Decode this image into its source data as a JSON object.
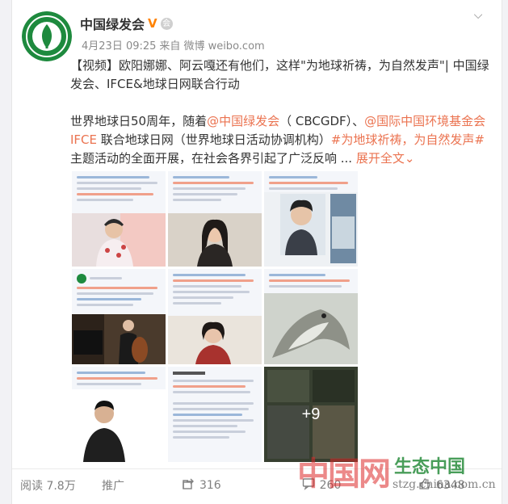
{
  "post": {
    "author": "中国绿发会",
    "verified_mark": "V",
    "vip_mark": "会",
    "date": "4月23日 09:25",
    "source_prefix": "来自",
    "source": "微博 weibo.com",
    "para1": "【视频】欧阳娜娜、阿云嘎还有他们，这样\"为地球祈祷，为自然发声\"| 中国绿发会、IFCE&地球日网联合行动",
    "para2_a": "世界地球日50周年，随着",
    "mention1": "@中国绿发会",
    "para2_b": "（ CBCGDF）、",
    "mention2": "@国际中国环境基金会IFCE",
    "para2_c": " 联合地球日网（世界地球日活动协调机构）",
    "hashtag": "#为地球祈祷，为自然发声#",
    "para2_d": " 主题活动的全面开展，在社会各界引起了广泛反响 ... ",
    "expand": "展开全文",
    "expand_icon": "chevron-down"
  },
  "images": {
    "more_count": "+9"
  },
  "footer": {
    "reads": "阅读 7.8万",
    "promote": "推广",
    "reposts": "316",
    "comments": "260",
    "likes": "6348"
  },
  "watermark": {
    "cn": "中国网",
    "eco": "生态中国",
    "url": "stzg.china.com.cn"
  },
  "colors": {
    "link": "#eb7350",
    "verified": "#ff8200",
    "avatar_green": "#1e8a3e"
  }
}
